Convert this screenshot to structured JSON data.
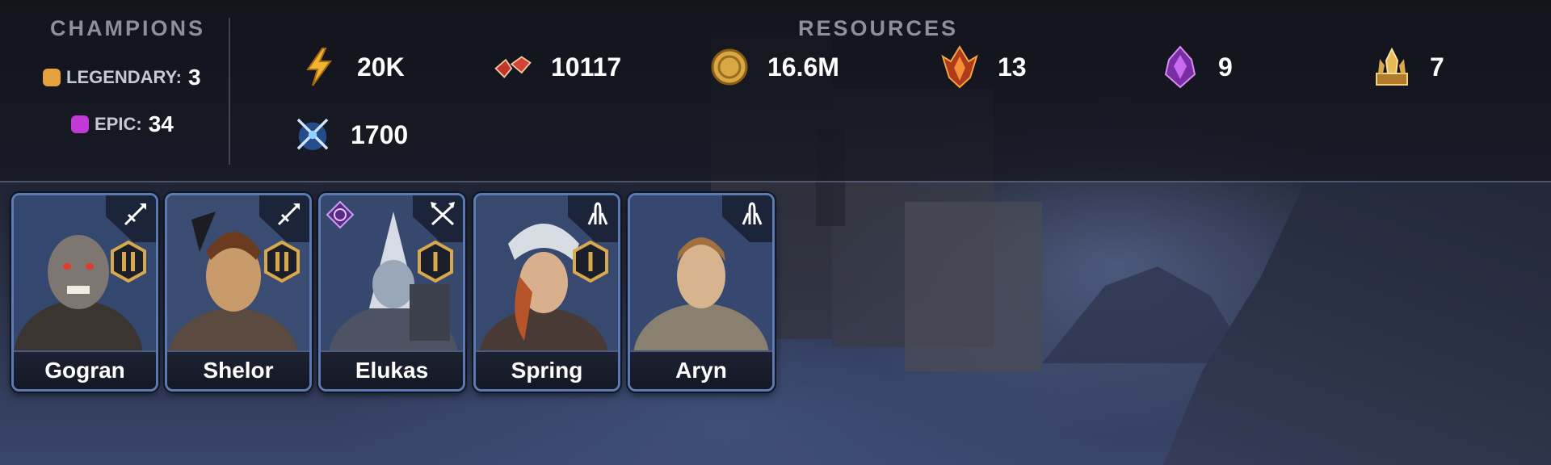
{
  "champions": {
    "title": "CHAMPIONS",
    "rarities": [
      {
        "label": "LEGENDARY:",
        "count": "3",
        "color": "#e5a23a"
      },
      {
        "label": "EPIC:",
        "count": "34",
        "color": "#c23ad6"
      }
    ]
  },
  "resources": {
    "title": "RESOURCES",
    "items": [
      {
        "icon": "energy-bolt-icon",
        "value": "20K"
      },
      {
        "icon": "rubies-icon",
        "value": "10117"
      },
      {
        "icon": "gold-coin-icon",
        "value": "16.6M"
      },
      {
        "icon": "ancient-shard-icon",
        "value": "13"
      },
      {
        "icon": "void-shard-icon",
        "value": "9"
      },
      {
        "icon": "sacred-shard-icon",
        "value": "7"
      },
      {
        "icon": "arena-tokens-icon",
        "value": "1700"
      }
    ]
  },
  "cards": [
    {
      "name": "Gogran",
      "class": "attack",
      "rank": "II",
      "affinity": null
    },
    {
      "name": "Shelor",
      "class": "attack",
      "rank": "II",
      "affinity": null
    },
    {
      "name": "Elukas",
      "class": "defense",
      "rank": "I",
      "affinity": "void"
    },
    {
      "name": "Spring",
      "class": "support",
      "rank": "I",
      "affinity": null
    },
    {
      "name": "Aryn",
      "class": "support",
      "rank": "",
      "affinity": null
    }
  ],
  "colors": {
    "legendary": "#e5a23a",
    "epic": "#c23ad6",
    "card_border": "#5d79b2",
    "badge_gold": "#d9a84a"
  }
}
